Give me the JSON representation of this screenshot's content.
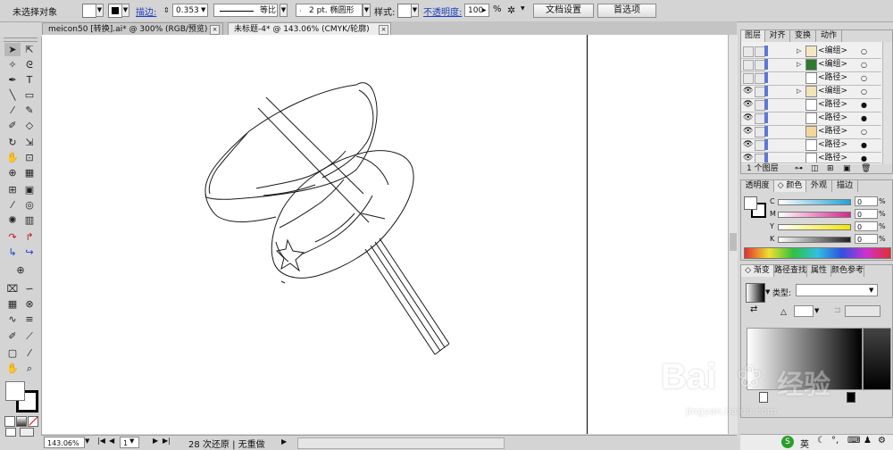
{
  "control_bar": {
    "selection_label": "未选择对象",
    "stroke_label": "描边:",
    "stroke_value": "0.353",
    "stroke_profile": "等比",
    "brush_label": "2 pt. 椭圆形",
    "style_label": "样式:",
    "opacity_label": "不透明度:",
    "opacity_value": "100",
    "percent": "%",
    "doc_setup_button": "文档设置",
    "preferences_button": "首选项"
  },
  "tabs": [
    {
      "label": "meicon50 [转换].ai* @ 300% (RGB/预览)"
    },
    {
      "label": "未标题-4* @ 143.06% (CMYK/轮廓)"
    }
  ],
  "status_bar": {
    "zoom": "143.06%",
    "page": "1",
    "undo_text": "28 次还原 | 无重做"
  },
  "layers_panel": {
    "tabs": [
      "图层",
      "对齐",
      "变换",
      "动作"
    ],
    "rows": [
      {
        "label": "<编组>"
      },
      {
        "label": "<编组>"
      },
      {
        "label": "<路径>"
      },
      {
        "label": "<编组>"
      },
      {
        "label": "<路径>"
      },
      {
        "label": "<路径>"
      },
      {
        "label": "<路径>"
      },
      {
        "label": "<路径>"
      },
      {
        "label": "<路径>"
      }
    ],
    "footer": "1 个图层"
  },
  "color_panel": {
    "tabs": [
      "透明度",
      "颜色",
      "外观",
      "描边"
    ],
    "channels": [
      {
        "name": "C",
        "value": "0",
        "color": "#1fa3d8"
      },
      {
        "name": "M",
        "value": "0",
        "color": "#d8248f"
      },
      {
        "name": "Y",
        "value": "0",
        "color": "#f2e600"
      },
      {
        "name": "K",
        "value": "0",
        "color": "#222222"
      }
    ]
  },
  "gradient_panel": {
    "tabs": [
      "渐变",
      "路径查找",
      "属性",
      "颜色参考"
    ],
    "type_label": "类型:"
  },
  "taskbar": {
    "ime_label": "英"
  },
  "watermark": {
    "brand": "Bai",
    "brand2": "经验",
    "url": "jingyan.baidu.com"
  }
}
